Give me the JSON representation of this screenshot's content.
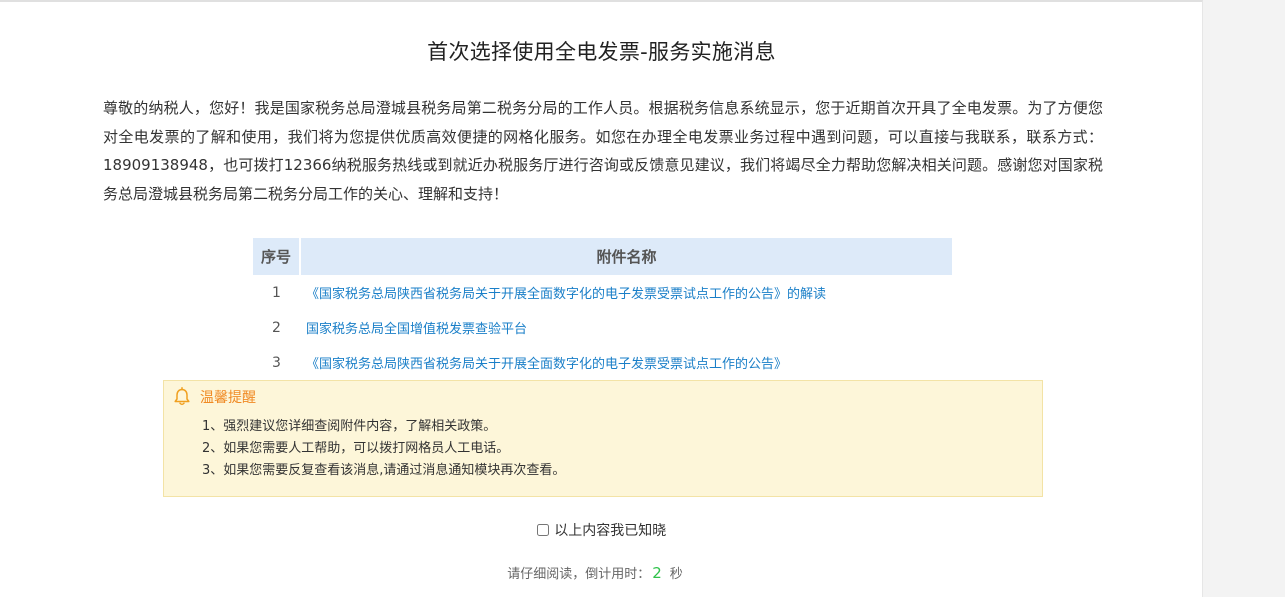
{
  "notice": {
    "title": "首次选择使用全电发票-服务实施消息",
    "body": "尊敬的纳税人，您好！我是国家税务总局澄城县税务局第二税务分局的工作人员。根据税务信息系统显示，您于近期首次开具了全电发票。为了方便您对全电发票的了解和使用，我们将为您提供优质高效便捷的网格化服务。如您在办理全电发票业务过程中遇到问题，可以直接与我联系，联系方式：18909138948，也可拨打12366纳税服务热线或到就近办税服务厅进行咨询或反馈意见建议，我们将竭尽全力帮助您解决相关问题。感谢您对国家税务总局澄城县税务局第二税务分局工作的关心、理解和支持！"
  },
  "attachments": {
    "headers": {
      "no": "序号",
      "name": "附件名称"
    },
    "rows": [
      {
        "no": "1",
        "name": "《国家税务总局陕西省税务局关于开展全面数字化的电子发票受票试点工作的公告》的解读"
      },
      {
        "no": "2",
        "name": "国家税务总局全国增值税发票查验平台"
      },
      {
        "no": "3",
        "name": "《国家税务总局陕西省税务局关于开展全面数字化的电子发票受票试点工作的公告》"
      }
    ]
  },
  "tips": {
    "title": "温馨提醒",
    "icon": "bell-icon",
    "items": [
      "1、强烈建议您详细查阅附件内容，了解相关政策。",
      "2、如果您需要人工帮助，可以拨打网格员人工电话。",
      "3、如果您需要反复查看该消息,请通过消息通知模块再次查看。"
    ]
  },
  "confirm": {
    "label": "以上内容我已知晓",
    "checked": false
  },
  "countdown": {
    "prefix": "请仔细阅读，倒计用时：",
    "seconds": "2",
    "unit": "秒"
  },
  "colors": {
    "link": "#1a7fc8",
    "table_header_bg": "#ddeaf9",
    "tip_bg": "#fdf6d9",
    "tip_title": "#f08a24",
    "countdown_number": "#2fc24a"
  }
}
